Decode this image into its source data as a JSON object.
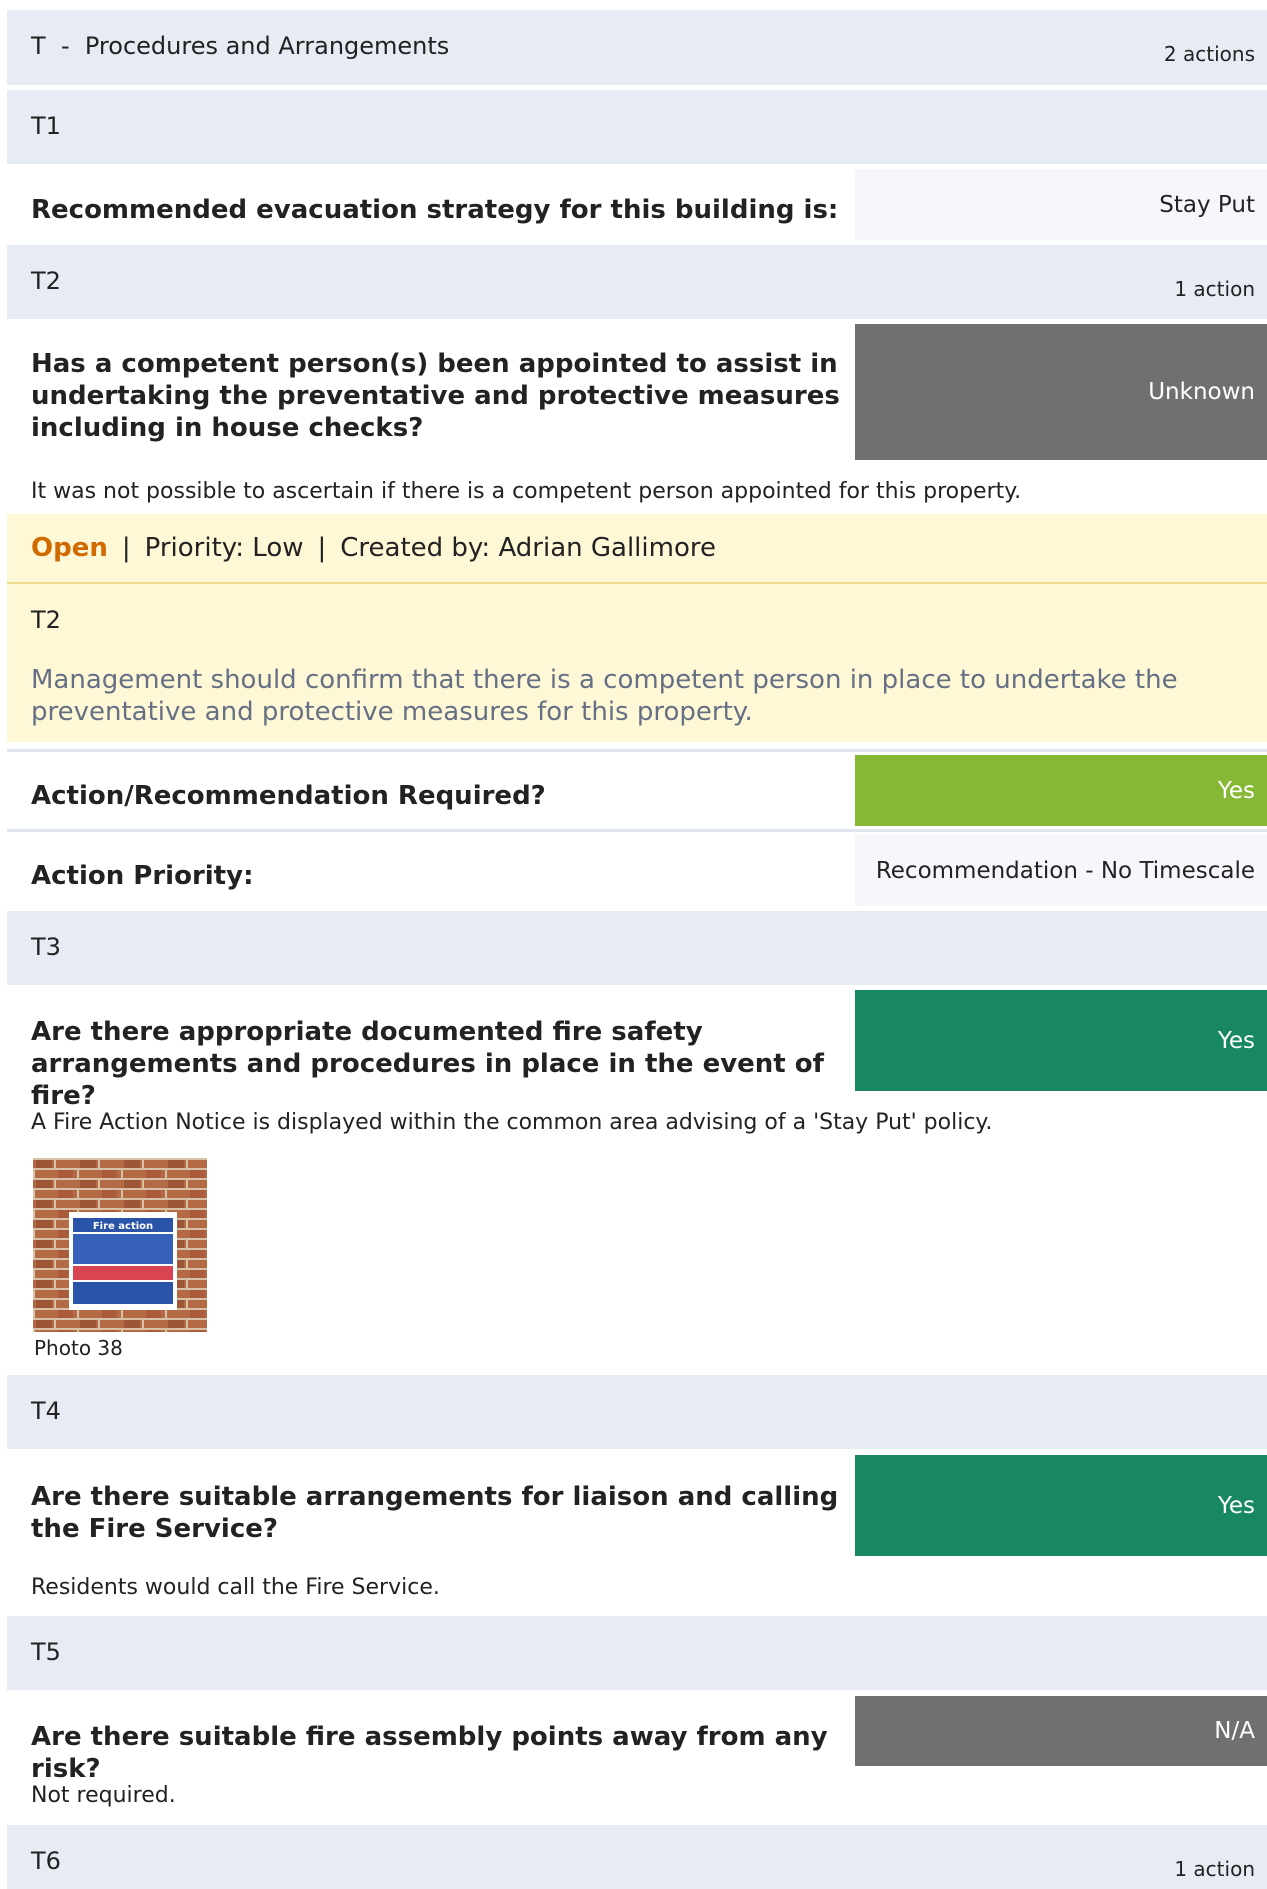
{
  "section": {
    "code": "T",
    "separator": "-",
    "title": "Procedures and Arrangements",
    "action_count": "2 actions"
  },
  "t1": {
    "code": "T1",
    "question": "Recommended evacuation strategy for this building is:",
    "answer": "Stay Put"
  },
  "t2": {
    "code": "T2",
    "action_count": "1 action",
    "question": "Has a competent person(s) been appointed to assist in undertaking the preventative and protective measures including in house checks?",
    "answer": "Unknown",
    "note": "It was not possible to ascertain if there is a competent person appointed for this property.",
    "action": {
      "status": "Open",
      "priority": "Priority: Low",
      "created_by": "Created by: Adrian Gallimore",
      "code": "T2",
      "description": "Management should confirm that there is a competent person in place to undertake the preventative and protective measures for this property."
    },
    "required_label": "Action/Recommendation Required?",
    "required_value": "Yes",
    "priority_label": "Action Priority:",
    "priority_value": "Recommendation - No Timescale"
  },
  "t3": {
    "code": "T3",
    "question": "Are there appropriate documented fire safety arrangements and procedures in place in the event of fire?",
    "answer": "Yes",
    "note": "A Fire Action Notice is displayed within the common area advising of a 'Stay Put' policy.",
    "photo_sign_text": "Fire action",
    "photo_caption": "Photo 38"
  },
  "t4": {
    "code": "T4",
    "question": "Are there suitable arrangements for liaison and calling the Fire Service?",
    "answer": "Yes",
    "note": "Residents would call the Fire Service."
  },
  "t5": {
    "code": "T5",
    "question": "Are there suitable fire assembly points away from any risk?",
    "answer": "N/A",
    "note": "Not required."
  },
  "t6": {
    "code": "T6",
    "action_count": "1 action"
  },
  "colors": {
    "header_band": "#e7ebf3",
    "answer_plain": "#f5f7fb",
    "answer_unknown": "#707070",
    "answer_required_yes": "#85b834",
    "answer_yes": "#188860",
    "action_background": "#fff8d6",
    "status_open": "#d06a00",
    "description_text": "#667085"
  }
}
